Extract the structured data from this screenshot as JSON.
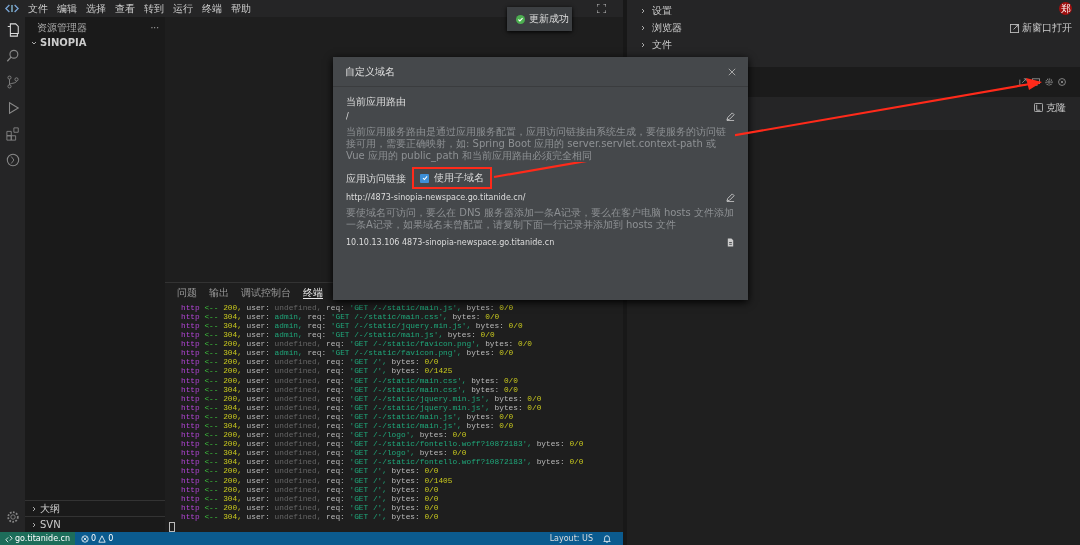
{
  "menu_bar": {
    "items": [
      "文件",
      "编辑",
      "选择",
      "查看",
      "转到",
      "运行",
      "终端",
      "帮助"
    ]
  },
  "toast": {
    "text": "更新成功"
  },
  "sidebar": {
    "title": "资源管理器",
    "more": "···",
    "folder": {
      "label": "SINOPIA",
      "expanded": true
    },
    "bottom_sections": [
      {
        "label": "大纲",
        "expanded": false
      },
      {
        "label": "SVN",
        "expanded": false
      }
    ]
  },
  "panel": {
    "tabs": [
      {
        "label": "问题",
        "selected": false
      },
      {
        "label": "输出",
        "selected": false
      },
      {
        "label": "调试控制台",
        "selected": false
      },
      {
        "label": "终端",
        "selected": true
      }
    ],
    "terminal_lines": [
      {
        "kind": "guest",
        "tokens": [
          "http",
          "<--",
          "200,",
          "user:",
          "undefined,",
          "req:",
          "'GET /-/static/main.js',",
          "bytes:",
          "0/0"
        ]
      },
      {
        "kind": "user",
        "tokens": [
          "http",
          "<--",
          "304,",
          "user:",
          "admin,",
          "req:",
          "'GET /-/static/main.css',",
          "bytes:",
          "0/0"
        ]
      },
      {
        "kind": "user",
        "tokens": [
          "http",
          "<--",
          "304,",
          "user:",
          "admin,",
          "req:",
          "'GET /-/static/jquery.min.js',",
          "bytes:",
          "0/0"
        ]
      },
      {
        "kind": "user",
        "tokens": [
          "http",
          "<--",
          "304,",
          "user:",
          "admin,",
          "req:",
          "'GET /-/static/main.js',",
          "bytes:",
          "0/0"
        ]
      },
      {
        "kind": "guest",
        "tokens": [
          "http",
          "<--",
          "200,",
          "user:",
          "undefined,",
          "req:",
          "'GET /-/static/favicon.png',",
          "bytes:",
          "0/0"
        ]
      },
      {
        "kind": "user",
        "tokens": [
          "http",
          "<--",
          "304,",
          "user:",
          "admin,",
          "req:",
          "'GET /-/static/favicon.png',",
          "bytes:",
          "0/0"
        ]
      },
      {
        "kind": "guest",
        "tokens": [
          "http",
          "<--",
          "200,",
          "user:",
          "undefined,",
          "req:",
          "'GET /',",
          "bytes:",
          "0/0"
        ]
      },
      {
        "kind": "guest",
        "tokens": [
          "http",
          "<--",
          "200,",
          "user:",
          "undefined,",
          "req:",
          "'GET /',",
          "bytes:",
          "0/1425"
        ]
      },
      {
        "kind": "guest",
        "tokens": [
          "http",
          "<--",
          "200,",
          "user:",
          "undefined,",
          "req:",
          "'GET /-/static/main.css',",
          "bytes:",
          "0/0"
        ]
      },
      {
        "kind": "guest",
        "tokens": [
          "http",
          "<--",
          "304,",
          "user:",
          "undefined,",
          "req:",
          "'GET /-/static/main.css',",
          "bytes:",
          "0/0"
        ]
      },
      {
        "kind": "guest",
        "tokens": [
          "http",
          "<--",
          "200,",
          "user:",
          "undefined,",
          "req:",
          "'GET /-/static/jquery.min.js',",
          "bytes:",
          "0/0"
        ]
      },
      {
        "kind": "guest",
        "tokens": [
          "http",
          "<--",
          "304,",
          "user:",
          "undefined,",
          "req:",
          "'GET /-/static/jquery.min.js',",
          "bytes:",
          "0/0"
        ]
      },
      {
        "kind": "guest",
        "tokens": [
          "http",
          "<--",
          "200,",
          "user:",
          "undefined,",
          "req:",
          "'GET /-/static/main.js',",
          "bytes:",
          "0/0"
        ]
      },
      {
        "kind": "guest",
        "tokens": [
          "http",
          "<--",
          "304,",
          "user:",
          "undefined,",
          "req:",
          "'GET /-/static/main.js',",
          "bytes:",
          "0/0"
        ]
      },
      {
        "kind": "guest",
        "tokens": [
          "http",
          "<--",
          "200,",
          "user:",
          "undefined,",
          "req:",
          "'GET /-/logo',",
          "bytes:",
          "0/0"
        ]
      },
      {
        "kind": "guest",
        "tokens": [
          "http",
          "<--",
          "200,",
          "user:",
          "undefined,",
          "req:",
          "'GET /-/static/fontello.woff?10872183',",
          "bytes:",
          "0/0"
        ]
      },
      {
        "kind": "guest",
        "tokens": [
          "http",
          "<--",
          "304,",
          "user:",
          "undefined,",
          "req:",
          "'GET /-/logo',",
          "bytes:",
          "0/0"
        ]
      },
      {
        "kind": "guest",
        "tokens": [
          "http",
          "<--",
          "304,",
          "user:",
          "undefined,",
          "req:",
          "'GET /-/static/fontello.woff?10872183',",
          "bytes:",
          "0/0"
        ]
      },
      {
        "kind": "guest",
        "tokens": [
          "http",
          "<--",
          "200,",
          "user:",
          "undefined,",
          "req:",
          "'GET /',",
          "bytes:",
          "0/0"
        ]
      },
      {
        "kind": "guest",
        "tokens": [
          "http",
          "<--",
          "200,",
          "user:",
          "undefined,",
          "req:",
          "'GET /',",
          "bytes:",
          "0/1405"
        ]
      },
      {
        "kind": "guest",
        "tokens": [
          "http",
          "<--",
          "200,",
          "user:",
          "undefined,",
          "req:",
          "'GET /',",
          "bytes:",
          "0/0"
        ]
      },
      {
        "kind": "guest",
        "tokens": [
          "http",
          "<--",
          "304,",
          "user:",
          "undefined,",
          "req:",
          "'GET /',",
          "bytes:",
          "0/0"
        ]
      },
      {
        "kind": "guest",
        "tokens": [
          "http",
          "<--",
          "200,",
          "user:",
          "undefined,",
          "req:",
          "'GET /',",
          "bytes:",
          "0/0"
        ]
      },
      {
        "kind": "guest",
        "tokens": [
          "http",
          "<--",
          "304,",
          "user:",
          "undefined,",
          "req:",
          "'GET /',",
          "bytes:",
          "0/0"
        ]
      }
    ]
  },
  "status_bar": {
    "remote": "go.titanide.cn",
    "errors": "0",
    "warnings": "0",
    "layout": "Layout: US"
  },
  "right_panel": {
    "avatar": "郑",
    "items": [
      {
        "label": "设置",
        "expanded": false
      },
      {
        "label": "浏览器",
        "expanded": false
      },
      {
        "label": "文件",
        "expanded": false
      }
    ],
    "open_new_window": "新窗口打开",
    "clone": "克隆"
  },
  "modal": {
    "title": "自定义域名",
    "route_label": "当前应用路由",
    "route_value": "/",
    "route_help": "当前应用服务路由是通过应用服务配置，应用访问链接由系统生成，要使服务的访问链接可用，需要正确映射，如: Spring Boot 应用的 server.servlet.context-path 或 Vue 应用的 public_path 和当前应用路由必须完全相同",
    "link_label": "应用访问链接",
    "subdomain": {
      "label": "使用子域名",
      "checked": true
    },
    "url": "http://4873-sinopia-newspace.go.titanide.cn/",
    "dns_help": "要使域名可访问，要么在 DNS 服务器添加一条A记录，要么在客户电脑 hosts 文件添加一条A记录，如果域名未曾配置，请复制下面一行记录并添加到 hosts 文件",
    "hosts_record": "10.10.13.106 4873-sinopia-newspace.go.titanide.cn"
  }
}
